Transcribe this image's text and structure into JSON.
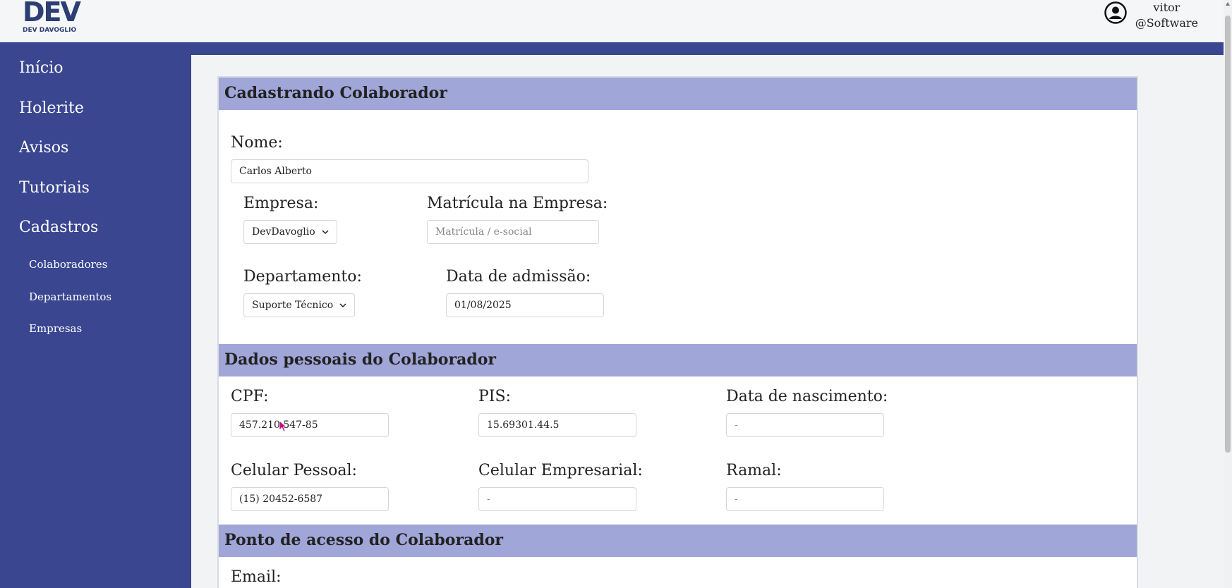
{
  "header": {
    "logo_mark": "DEV",
    "logo_text": "DEV DAVOGLIO",
    "user_name": "vitor",
    "user_company": "@Software"
  },
  "sidebar": {
    "items": [
      {
        "label": "Início"
      },
      {
        "label": "Holerite"
      },
      {
        "label": "Avisos"
      },
      {
        "label": "Tutoriais"
      },
      {
        "label": "Cadastros"
      }
    ],
    "subitems": [
      {
        "label": "Colaboradores"
      },
      {
        "label": "Departamentos"
      },
      {
        "label": "Empresas"
      }
    ]
  },
  "form": {
    "section1_title": "Cadastrando Colaborador",
    "nome_label": "Nome:",
    "nome_value": "Carlos Alberto",
    "empresa_label": "Empresa:",
    "empresa_value": "DevDavoglio",
    "matricula_label": "Matrícula na Empresa:",
    "matricula_placeholder": "Matrícula / e-social",
    "departamento_label": "Departamento:",
    "departamento_value": "Suporte Técnico",
    "admissao_label": "Data de admissão:",
    "admissao_value": "01/08/2025",
    "section2_title": "Dados pessoais do Colaborador",
    "cpf_label": "CPF:",
    "cpf_value": "457.210.547-85",
    "pis_label": "PIS:",
    "pis_value": "15.69301.44.5",
    "nascimento_label": "Data de nascimento:",
    "nascimento_placeholder": "-",
    "celular_pessoal_label": "Celular Pessoal:",
    "celular_pessoal_value": "(15) 20452-6587",
    "celular_empresarial_label": "Celular Empresarial:",
    "celular_empresarial_placeholder": "-",
    "ramal_label": "Ramal:",
    "ramal_placeholder": "-",
    "section3_title": "Ponto de acesso do Colaborador",
    "email_label": "Email:"
  },
  "colors": {
    "sidebar": "#3a4690",
    "section_header": "#a0a6d8"
  }
}
